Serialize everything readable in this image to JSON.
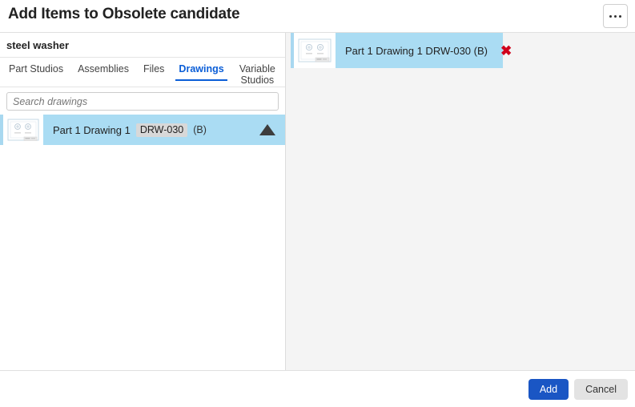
{
  "dialog": {
    "title": "Add Items to Obsolete candidate",
    "menu_icon": "overflow-menu-icon"
  },
  "left_panel": {
    "document_name": "steel washer",
    "tabs": [
      {
        "label": "Part Studios",
        "active": false
      },
      {
        "label": "Assemblies",
        "active": false
      },
      {
        "label": "Files",
        "active": false
      },
      {
        "label": "Drawings",
        "active": true
      },
      {
        "label": "Variable Studios",
        "active": false
      }
    ],
    "search": {
      "placeholder": "Search drawings",
      "value": ""
    },
    "results": [
      {
        "name": "Part 1 Drawing 1",
        "part_number": "DRW-030",
        "revision": "(B)",
        "thumbnail_icon": "drawing-thumbnail-icon",
        "expand_icon": "triangle-up-icon",
        "selected": true
      }
    ]
  },
  "right_panel": {
    "selected_items": [
      {
        "label": "Part 1 Drawing 1 DRW-030 (B)",
        "thumbnail_icon": "drawing-thumbnail-icon",
        "remove_icon": "close-x-icon",
        "remove_label": "✖"
      }
    ]
  },
  "footer": {
    "add_label": "Add",
    "cancel_label": "Cancel"
  },
  "colors": {
    "accent_blue": "#0b5ed7",
    "primary_button": "#1a56c4",
    "selection_blue": "#aadcf3",
    "accent_bar": "#a8d8f0",
    "remove_red": "#d0021b",
    "badge_gray": "#d8d8d8",
    "right_pane_bg": "#f4f4f4"
  }
}
